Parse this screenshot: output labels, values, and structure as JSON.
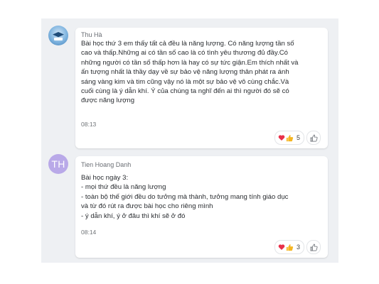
{
  "messages": [
    {
      "author": "Thu Hà",
      "avatar": "school-logo",
      "text": "Bài học thứ 3 em thấy tất cả đều là năng lượng. Có năng lượng tần số\ncao và thấp.Những ai có tần số cao là có tình yêu thương đủ đầy.Có\nnhững người có tần số thấp hơn là hay có sự tức giận.Em thích nhất và\nấn tượng nhất là thầy dạy về sự bảo vệ năng lượng thân phát ra ánh\nsáng vàng kim và tim cũng vậy nó là một sự bảo vệ vô cùng chắc.Và\ncuối cùng là ý dẫn khí. Ý của chúng ta nghĩ đến ai thì người đó sẽ có\nđược năng lượng",
      "time": "08:13",
      "reaction_icons": [
        "heart-icon",
        "thumbs-up-icon"
      ],
      "reaction_count": "5"
    },
    {
      "author": "Tien Hoang Danh",
      "avatar_initials": "TH",
      "text": "Bài học ngày 3:\n- mọi thứ đều là năng lượng\n- toàn bộ thế giới đều do tưởng mà thành, tưởng mang tính giáo dục\nvà từ đó rút ra được bài học cho riêng mình\n- ý dẫn khí, ý ở đâu thì khí sẽ ở đó",
      "time": "08:14",
      "reaction_icons": [
        "heart-icon",
        "thumbs-up-icon"
      ],
      "reaction_count": "3"
    }
  ],
  "colors": {
    "canvas_bg": "#eef0f3",
    "bubble_bg": "#ffffff",
    "avatar_th": "#b9a9e8",
    "heart": "#e8304a",
    "thumb": "#f5b622"
  }
}
